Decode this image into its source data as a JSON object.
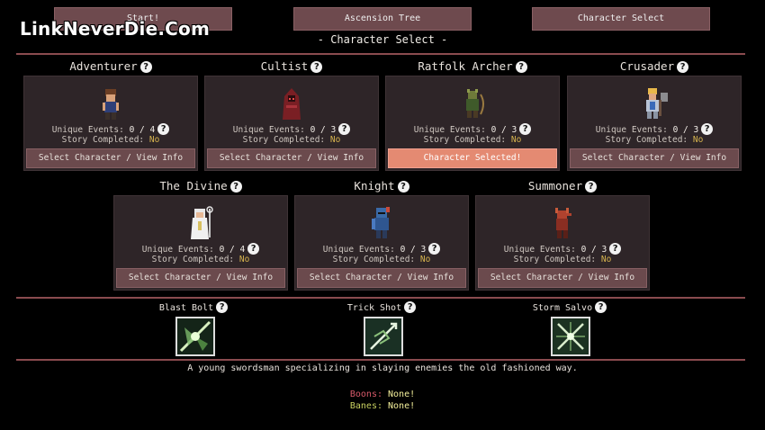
{
  "tabs": [
    {
      "label": "Start!"
    },
    {
      "label": "Ascension Tree"
    },
    {
      "label": "Character Select"
    }
  ],
  "watermark": "LinkNeverDie.Com",
  "section_title": "- Character Select -",
  "labels": {
    "unique_events": "Unique Events:",
    "story_completed": "Story Completed:",
    "help": "?"
  },
  "characters": [
    {
      "name": "Adventurer",
      "events": "0 / 4",
      "story": "No",
      "button": "Select Character / View Info"
    },
    {
      "name": "Cultist",
      "events": "0 / 3",
      "story": "No",
      "button": "Select Character / View Info"
    },
    {
      "name": "Ratfolk Archer",
      "events": "0 / 3",
      "story": "No",
      "button": "Character Selected!"
    },
    {
      "name": "Crusader",
      "events": "0 / 3",
      "story": "No",
      "button": "Select Character / View Info"
    },
    {
      "name": "The Divine",
      "events": "0 / 4",
      "story": "No",
      "button": "Select Character / View Info"
    },
    {
      "name": "Knight",
      "events": "0 / 3",
      "story": "No",
      "button": "Select Character / View Info"
    },
    {
      "name": "Summoner",
      "events": "0 / 3",
      "story": "No",
      "button": "Select Character / View Info"
    }
  ],
  "abilities": [
    {
      "name": "Blast Bolt",
      "icon": "blast-bolt-icon"
    },
    {
      "name": "Trick Shot",
      "icon": "trick-shot-icon"
    },
    {
      "name": "Storm Salvo",
      "icon": "storm-salvo-icon"
    }
  ],
  "description": "A young swordsman specializing in slaying enemies the old fashioned way.",
  "boons": {
    "label": "Boons:",
    "value": "None!"
  },
  "banes": {
    "label": "Banes:",
    "value": "None!"
  },
  "colors": {
    "accent_line": "#8a4b4f",
    "selected_button": "#e48a72",
    "story_no": "#d6b34e",
    "boons_label": "#d85a6a",
    "banes_label": "#c8d060"
  }
}
